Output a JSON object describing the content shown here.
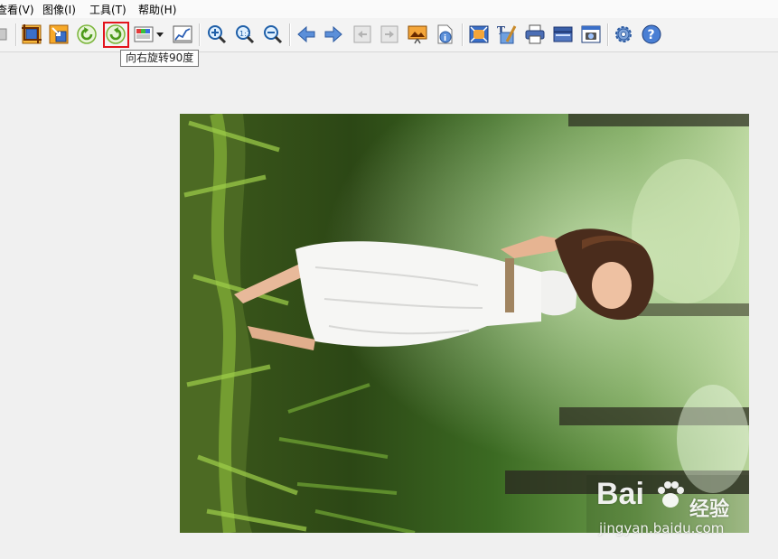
{
  "menubar": {
    "items": [
      {
        "label": "查看(V)"
      },
      {
        "label": "图像(I)"
      },
      {
        "label": "工具(T)"
      },
      {
        "label": "帮助(H)"
      }
    ]
  },
  "toolbar": {
    "buttons": [
      {
        "icon": "partial-toolbar-icon"
      },
      {
        "icon": "crop-icon"
      },
      {
        "icon": "resize-icon"
      },
      {
        "icon": "rotate-left-icon"
      },
      {
        "icon": "rotate-right-icon",
        "selected": true
      },
      {
        "icon": "color-adjust-icon"
      },
      {
        "icon": "dropdown-arrow-icon"
      },
      {
        "icon": "histogram-icon"
      },
      {
        "icon": "zoom-in-icon"
      },
      {
        "icon": "actual-size-icon"
      },
      {
        "icon": "zoom-out-icon"
      },
      {
        "icon": "previous-icon"
      },
      {
        "icon": "next-icon"
      },
      {
        "icon": "first-page-icon"
      },
      {
        "icon": "last-page-icon"
      },
      {
        "icon": "slideshow-icon"
      },
      {
        "icon": "image-info-icon"
      },
      {
        "icon": "fullscreen-icon"
      },
      {
        "icon": "add-text-icon"
      },
      {
        "icon": "print-icon"
      },
      {
        "icon": "scan-icon"
      },
      {
        "icon": "capture-icon"
      },
      {
        "icon": "settings-icon"
      },
      {
        "icon": "help-icon"
      }
    ]
  },
  "tooltip": {
    "text": "向右旋转90度"
  },
  "image": {
    "content": "rotated photo of woman in white dress in forest"
  },
  "watermark": {
    "brand": "Bai",
    "sub": "经验",
    "url": "jingyan.baidu.com"
  },
  "colors": {
    "highlight": "#e3141d",
    "background": "#f0f0f0"
  }
}
